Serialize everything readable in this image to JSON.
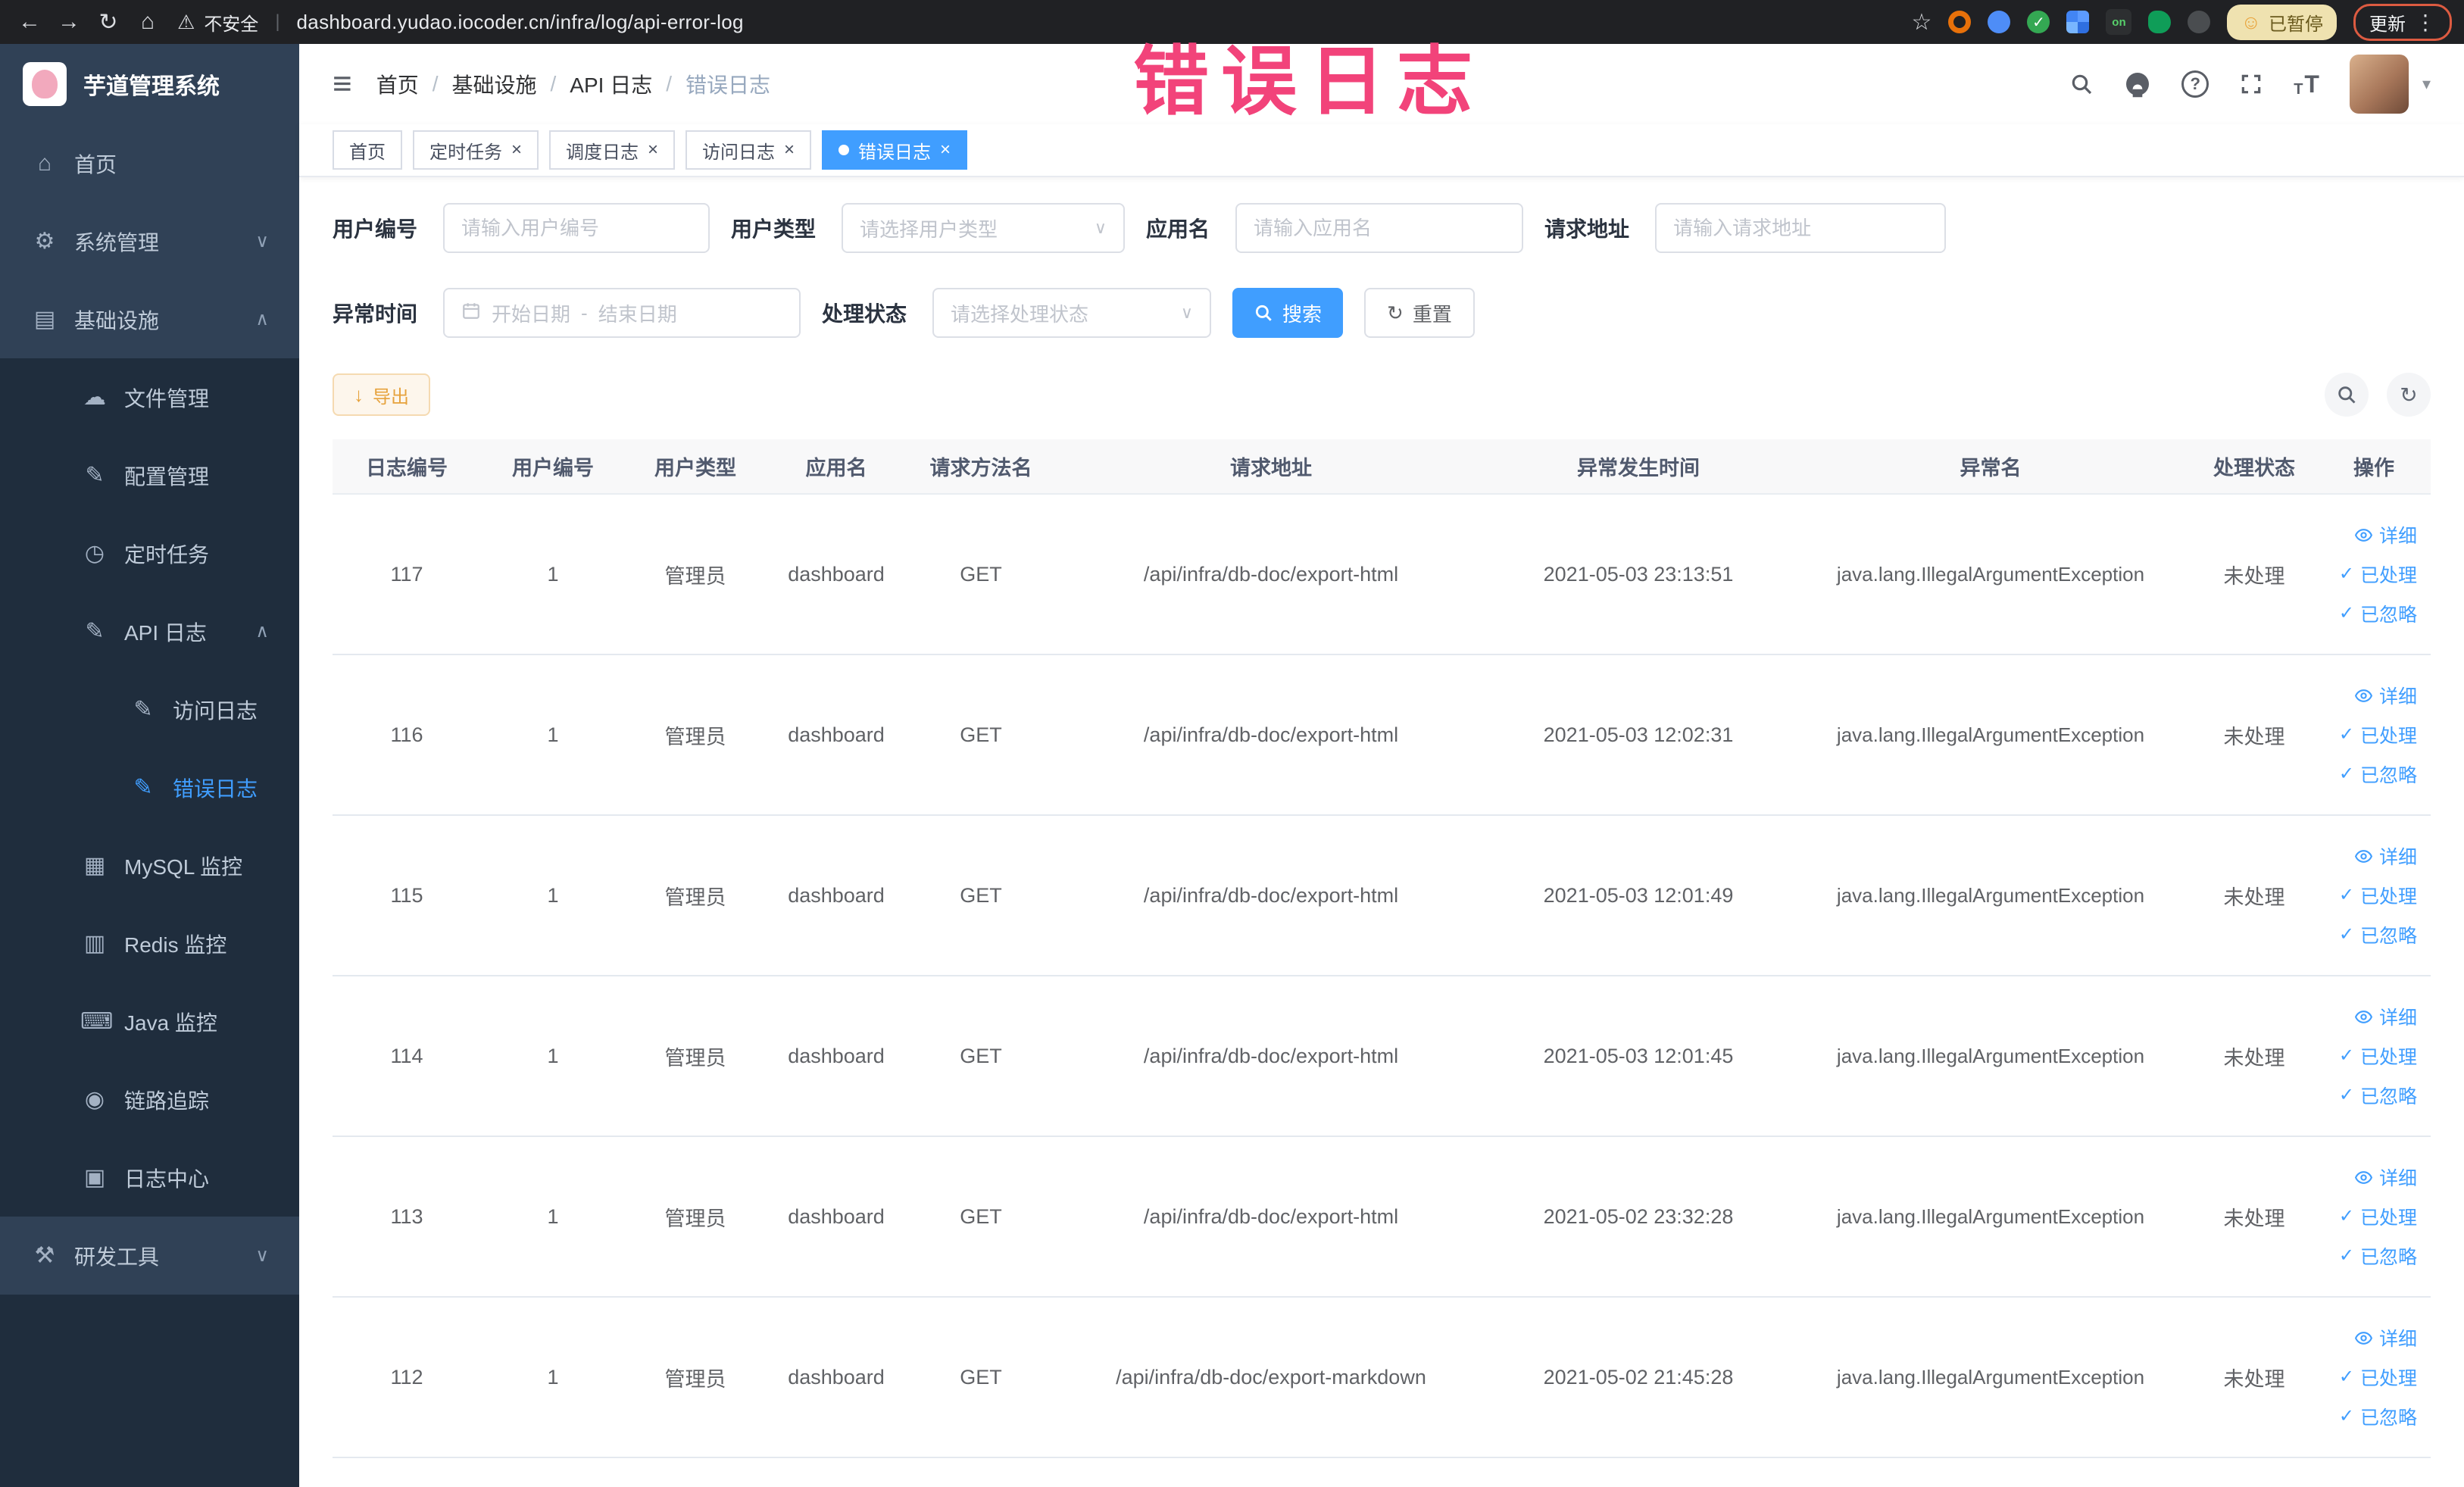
{
  "browser": {
    "security_label": "不安全",
    "url": "dashboard.yudao.iocoder.cn/infra/log/api-error-log",
    "ext_on_label": "on",
    "paused_badge": "已暂停",
    "update_button": "更新"
  },
  "annotation": {
    "text": "错误日志",
    "color": "#f2437a"
  },
  "colors": {
    "accent": "#409eff",
    "sidebar_bg": "#304156",
    "submenu_bg": "#1f2d3d",
    "warning_button_text": "#e6a23c",
    "table_header_bg": "#f8f8f9"
  },
  "icons": {
    "back": "←",
    "forward": "→",
    "reload": "↻",
    "home": "⌂",
    "warning": "⚠",
    "divider": "|",
    "star": "☆",
    "dots": "⋮",
    "smiley": "☺",
    "hamburger": "≡",
    "slash": "/",
    "caret_down": "∨",
    "caret_up": "∧",
    "close": "×",
    "check": "✓",
    "download": "↓",
    "refresh": "↻",
    "question": "?",
    "font_t": "T",
    "avatar_caret": "▾"
  },
  "sidebar": {
    "app_title": "芋道管理系统",
    "items": [
      {
        "label": "首页",
        "icon": "⌂"
      },
      {
        "label": "系统管理",
        "icon": "⚙",
        "chevron": "∨"
      },
      {
        "label": "基础设施",
        "icon": "▤",
        "chevron": "∧"
      },
      {
        "label": "文件管理",
        "icon": "☁"
      },
      {
        "label": "配置管理",
        "icon": "✎"
      },
      {
        "label": "定时任务",
        "icon": "◷"
      },
      {
        "label": "API 日志",
        "icon": "✎",
        "chevron": "∧"
      },
      {
        "label": "访问日志",
        "icon": "✎"
      },
      {
        "label": "错误日志",
        "icon": "✎",
        "active": true
      },
      {
        "label": "MySQL 监控",
        "icon": "▦"
      },
      {
        "label": "Redis 监控",
        "icon": "▥"
      },
      {
        "label": "Java 监控",
        "icon": "⌨"
      },
      {
        "label": "链路追踪",
        "icon": "◉"
      },
      {
        "label": "日志中心",
        "icon": "▣"
      },
      {
        "label": "研发工具",
        "icon": "⚒",
        "chevron": "∨"
      }
    ]
  },
  "header": {
    "breadcrumb": [
      {
        "label": "首页"
      },
      {
        "label": "基础设施"
      },
      {
        "label": "API 日志"
      },
      {
        "label": "错误日志",
        "current": true
      }
    ]
  },
  "tabs": [
    {
      "label": "首页",
      "closable": false,
      "active": false
    },
    {
      "label": "定时任务",
      "closable": true,
      "active": false
    },
    {
      "label": "调度日志",
      "closable": true,
      "active": false
    },
    {
      "label": "访问日志",
      "closable": true,
      "active": false
    },
    {
      "label": "错误日志",
      "closable": true,
      "active": true
    }
  ],
  "filters": {
    "user_id": {
      "label": "用户编号",
      "placeholder": "请输入用户编号"
    },
    "user_type": {
      "label": "用户类型",
      "placeholder": "请选择用户类型"
    },
    "app_name": {
      "label": "应用名",
      "placeholder": "请输入应用名"
    },
    "request_url": {
      "label": "请求地址",
      "placeholder": "请输入请求地址"
    },
    "exception_time": {
      "label": "异常时间",
      "start_placeholder": "开始日期",
      "separator": "-",
      "end_placeholder": "结束日期"
    },
    "process_status": {
      "label": "处理状态",
      "placeholder": "请选择处理状态"
    },
    "search_button": "搜索",
    "reset_button": "重置"
  },
  "toolbar": {
    "export_label": "导出"
  },
  "table": {
    "columns": [
      "日志编号",
      "用户编号",
      "用户类型",
      "应用名",
      "请求方法名",
      "请求地址",
      "异常发生时间",
      "异常名",
      "处理状态",
      "操作"
    ],
    "row_actions": [
      {
        "label": "详细"
      },
      {
        "label": "已处理"
      },
      {
        "label": "已忽略"
      }
    ],
    "rows": [
      {
        "id": "117",
        "user_id": "1",
        "user_type": "管理员",
        "app": "dashboard",
        "method": "GET",
        "url": "/api/infra/db-doc/export-html",
        "time": "2021-05-03 23:13:51",
        "exception": "java.lang.IllegalArgumentException",
        "status": "未处理"
      },
      {
        "id": "116",
        "user_id": "1",
        "user_type": "管理员",
        "app": "dashboard",
        "method": "GET",
        "url": "/api/infra/db-doc/export-html",
        "time": "2021-05-03 12:02:31",
        "exception": "java.lang.IllegalArgumentException",
        "status": "未处理"
      },
      {
        "id": "115",
        "user_id": "1",
        "user_type": "管理员",
        "app": "dashboard",
        "method": "GET",
        "url": "/api/infra/db-doc/export-html",
        "time": "2021-05-03 12:01:49",
        "exception": "java.lang.IllegalArgumentException",
        "status": "未处理"
      },
      {
        "id": "114",
        "user_id": "1",
        "user_type": "管理员",
        "app": "dashboard",
        "method": "GET",
        "url": "/api/infra/db-doc/export-html",
        "time": "2021-05-03 12:01:45",
        "exception": "java.lang.IllegalArgumentException",
        "status": "未处理"
      },
      {
        "id": "113",
        "user_id": "1",
        "user_type": "管理员",
        "app": "dashboard",
        "method": "GET",
        "url": "/api/infra/db-doc/export-html",
        "time": "2021-05-02 23:32:28",
        "exception": "java.lang.IllegalArgumentException",
        "status": "未处理"
      },
      {
        "id": "112",
        "user_id": "1",
        "user_type": "管理员",
        "app": "dashboard",
        "method": "GET",
        "url": "/api/infra/db-doc/export-markdown",
        "time": "2021-05-02 21:45:28",
        "exception": "java.lang.IllegalArgumentException",
        "status": "未处理"
      }
    ]
  }
}
